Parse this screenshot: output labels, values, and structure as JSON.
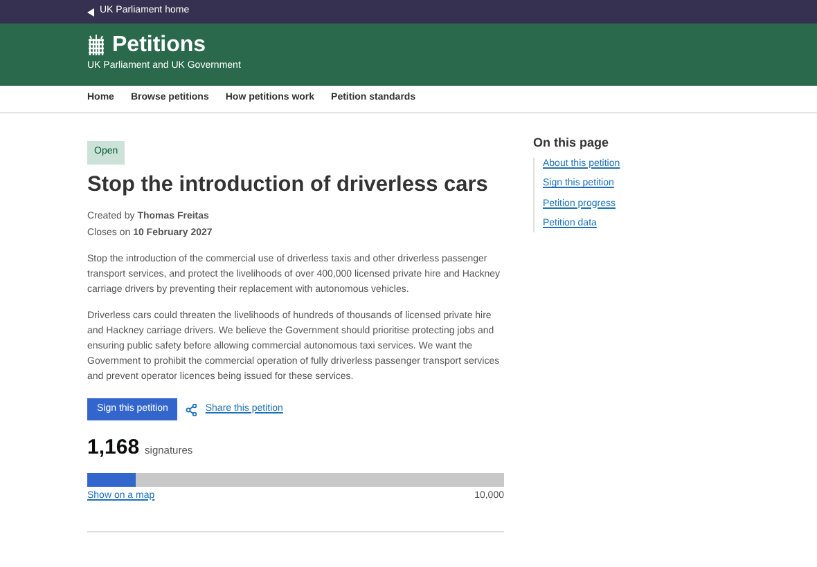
{
  "top_bar": {
    "link": "UK Parliament home"
  },
  "header": {
    "title": "Petitions",
    "subtitle": "UK Parliament and UK Government"
  },
  "nav": [
    "Home",
    "Browse petitions",
    "How petitions work",
    "Petition standards"
  ],
  "petition": {
    "status": "Open",
    "title": "Stop the introduction of driverless cars",
    "created_by": "Created by **Thomas Freitas**",
    "closes": "Closes on **10 February 2027**",
    "paragraphs": [
      "Stop the introduction of the commercial use of driverless taxis and other driverless passenger transport services, and protect the livelihoods of over 400,000 licensed private hire and Hackney carriage drivers by preventing their replacement with autonomous vehicles.",
      "Driverless cars could threaten the livelihoods of hundreds of thousands of licensed private hire and Hackney carriage drivers. We believe the Government should prioritise protecting jobs and ensuring public safety before allowing commercial autonomous taxi services. We want the Government to prohibit the commercial operation of fully driverless passenger transport services and prevent operator licences being issued for these services."
    ],
    "sign_button": "Sign this petition",
    "share_link": "Share this petition",
    "count": "1,168",
    "count_label": "signatures",
    "progress": {
      "level": 0.117
    },
    "map_link": "Show on a map",
    "target": "10,000"
  },
  "on_this_page": {
    "title": "On this page",
    "links": [
      "About this petition",
      "Sign this petition",
      "Petition progress",
      "Petition data"
    ]
  }
}
